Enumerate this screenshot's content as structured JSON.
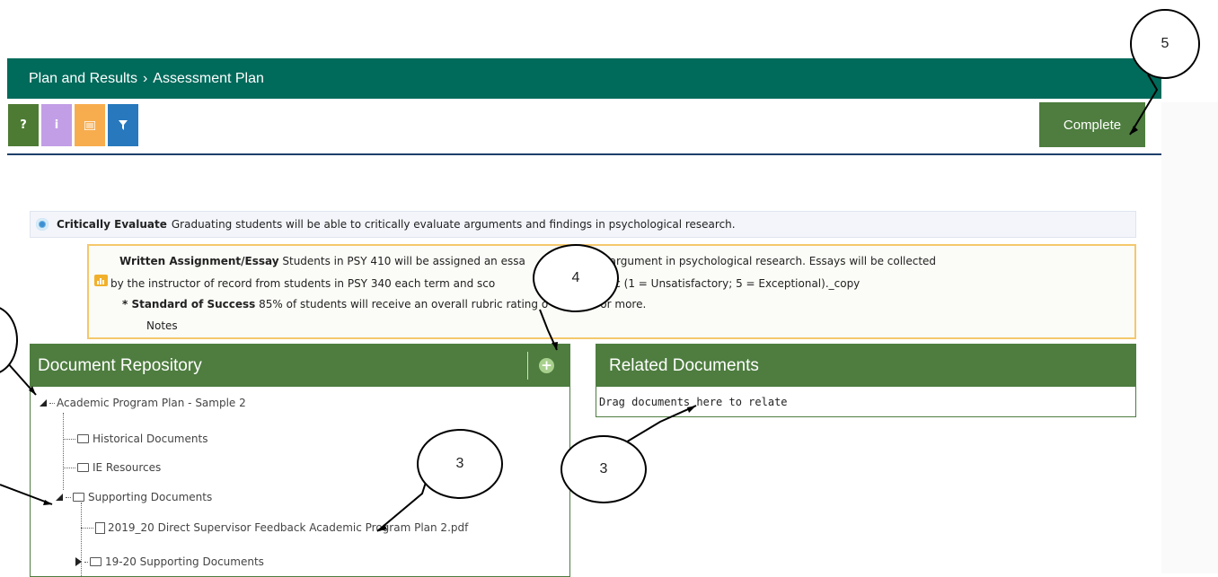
{
  "header": {
    "crumb_parent": "Plan and Results",
    "crumb_sep": "›",
    "crumb_current": "Assessment Plan"
  },
  "toolbar": {
    "help_label": "?",
    "info_label": "i",
    "complete_label": "Complete",
    "colors": {
      "help": "#4e7b34",
      "info": "#c29ee6",
      "notes": "#f7ad4e",
      "filter": "#2778bd",
      "complete": "#4e7d3f"
    }
  },
  "outcome": {
    "name": "Critically Evaluate",
    "text": "Graduating students will be able to critically evaluate arguments and findings in psychological research."
  },
  "measure": {
    "name": "Written Assignment/Essay",
    "line1": "Students in PSY 410 will be assigned an essa",
    "line1b": "argument in psychological research.  Essays will be collected",
    "line2a": "by the instructor of record from students in PSY 340 each term and sco",
    "line2b": "oint rubric (1 = Unsatisfactory; 5 = Exceptional)._copy",
    "standard_label": "* Standard of Success",
    "standard_text": "85% of students will receive an overall rubric rating o",
    "standard_tail": "out of 5 or more.",
    "notes_label": "Notes"
  },
  "doc_repository": {
    "title": "Document Repository",
    "add_icon": "plus-circle-icon",
    "tree": [
      {
        "label": "Academic Program Plan - Sample 2",
        "kind": "root",
        "expanded": true
      },
      {
        "label": "Historical Documents",
        "kind": "folder"
      },
      {
        "label": "IE Resources",
        "kind": "folder"
      },
      {
        "label": "Supporting Documents",
        "kind": "folder",
        "expanded": true
      },
      {
        "label": "2019_20 Direct Supervisor Feedback Academic Program Plan 2.pdf",
        "kind": "pdf"
      },
      {
        "label": "19-20 Supporting Documents",
        "kind": "folder",
        "expanded": false
      }
    ]
  },
  "related_documents": {
    "title": "Related Documents",
    "drop_hint": "Drag documents here to relate"
  },
  "callouts": {
    "c5": "5",
    "c4": "4",
    "c3a": "3",
    "c3b": "3"
  }
}
